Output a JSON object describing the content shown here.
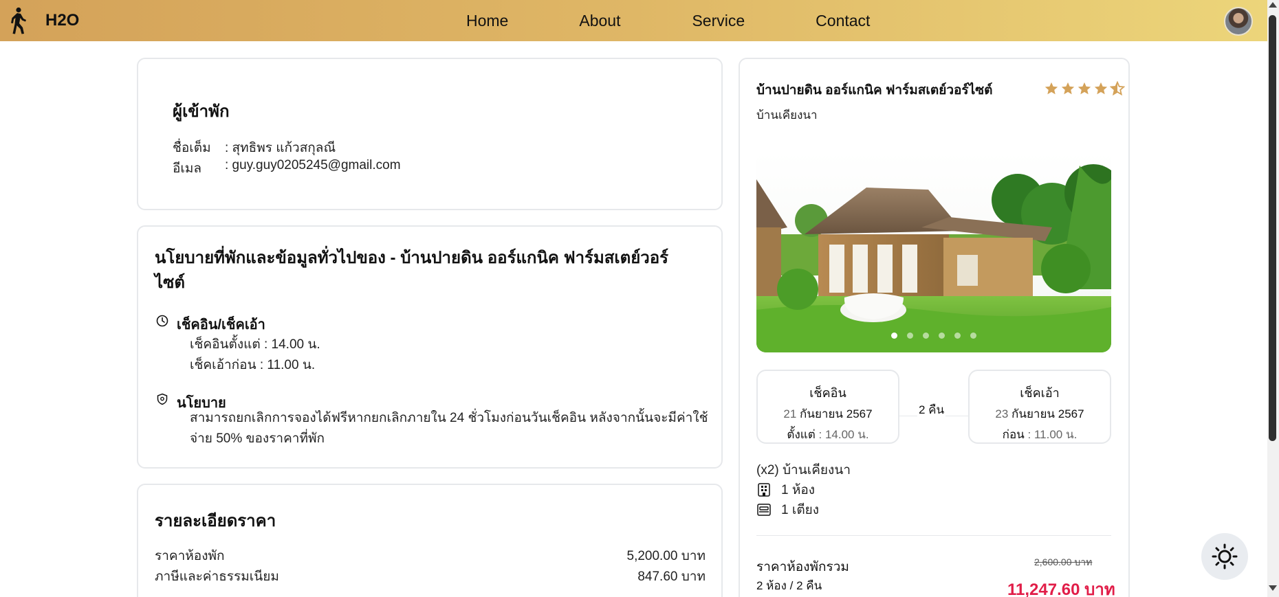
{
  "navbar": {
    "brand": "H2O",
    "links": [
      "Home",
      "About",
      "Service",
      "Contact"
    ]
  },
  "guest": {
    "title": "ผู้เข้าพัก",
    "name_label": "ชื่อเต็ม",
    "name_value": ": สุทธิพร แก้วสกุลณี",
    "email_label": "อีเมล",
    "email_value": ": guy.guy0205245@gmail.com"
  },
  "policy": {
    "title": "นโยบายที่พักและข้อมูลทั่วไปของ - บ้านปายดิน ออร์แกนิค ฟาร์มสเตย์วอร์ไซต์",
    "checkin_title": "เช็คอิน/เช็คเอ้า",
    "checkin_line": "เช็คอินตั้งแต่ : 14.00 น.",
    "checkout_line": "เช็คเอ้าก่อน : 11.00 น.",
    "policy_title": "นโยบาย",
    "policy_text": "สามารถยกเลิกการจองได้ฟรีหากยกเลิกภายใน 24 ชั่วโมงก่อนวันเช็คอิน หลังจากนั้นจะมีค่าใช้จ่าย 50% ของราคาที่พัก"
  },
  "price": {
    "title": "รายละเอียดราคา",
    "rows": [
      {
        "label": "ราคาห้องพัก",
        "value": "5,200.00 บาท"
      },
      {
        "label": "ภาษีและค่าธรรมเนียม",
        "value": "847.60 บาท"
      }
    ]
  },
  "booking": {
    "hotel_name": "บ้านปายดิน ออร์แกนิค ฟาร์มสเตย์วอร์ไซต์",
    "rating": 4.5,
    "room_type": "บ้านเคียงนา",
    "gallery": {
      "slide_count": 6,
      "active_index": 0
    },
    "checkin": {
      "title": "เช็คอิน",
      "day": "21",
      "month_year": "กันยายน 2567",
      "time_label": "ตั้งแต่",
      "time": ": 14.00 น."
    },
    "checkout": {
      "title": "เช็คเอ้า",
      "day": "23",
      "month_year": "กันยายน 2567",
      "time_label": "ก่อน",
      "time": ": 11.00 น."
    },
    "nights": "2 คืน",
    "room_summary": "(x2) บ้านเคียงนา",
    "rooms": "1 ห้อง",
    "beds": "1 เตียง",
    "total_label": "ราคาห้องพักรวม",
    "total_sub": "2 ห้อง / 2 คืน",
    "old_price": "2,600.00 บาท",
    "total_price": "11,247.60 บาท"
  },
  "colors": {
    "nav_gradient_start": "#d4a259",
    "nav_gradient_end": "#ecd57a",
    "star": "#d4a259",
    "total_price": "#e11d48",
    "border": "#e6e8eb"
  }
}
